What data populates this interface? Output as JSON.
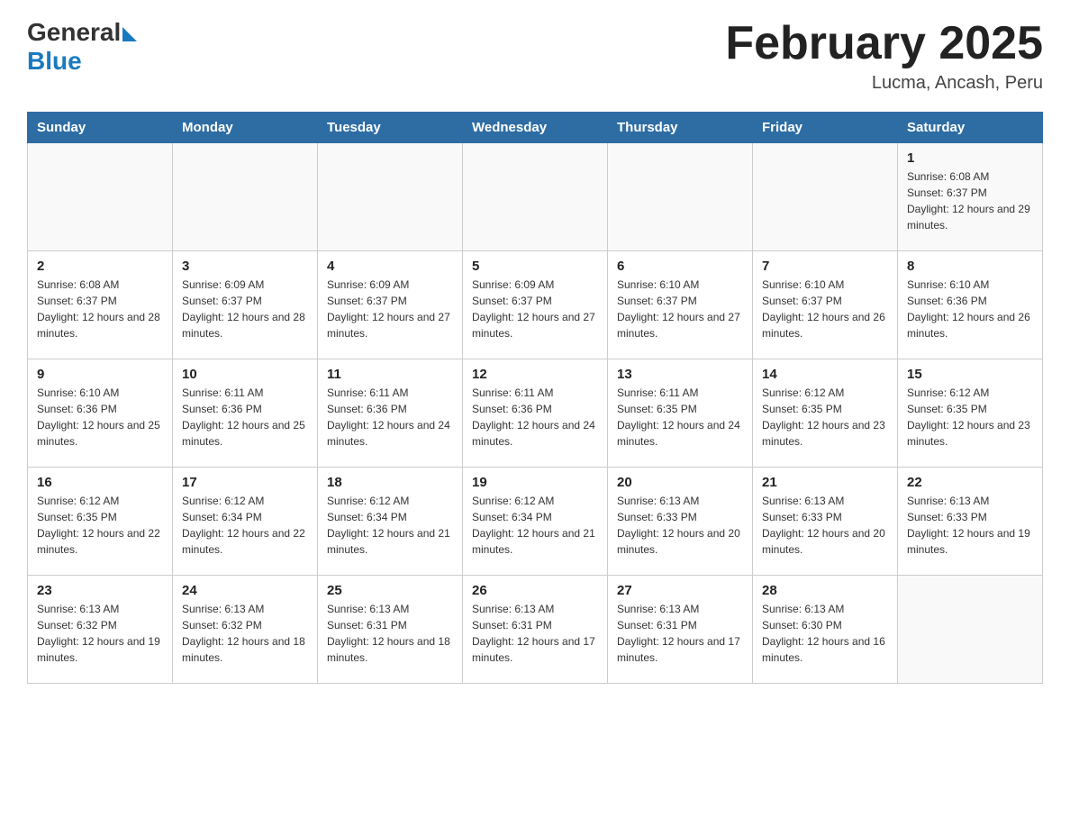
{
  "header": {
    "logo_general": "General",
    "logo_blue": "Blue",
    "month_title": "February 2025",
    "subtitle": "Lucma, Ancash, Peru"
  },
  "days_of_week": [
    "Sunday",
    "Monday",
    "Tuesday",
    "Wednesday",
    "Thursday",
    "Friday",
    "Saturday"
  ],
  "weeks": [
    [
      {
        "day": "",
        "sunrise": "",
        "sunset": "",
        "daylight": ""
      },
      {
        "day": "",
        "sunrise": "",
        "sunset": "",
        "daylight": ""
      },
      {
        "day": "",
        "sunrise": "",
        "sunset": "",
        "daylight": ""
      },
      {
        "day": "",
        "sunrise": "",
        "sunset": "",
        "daylight": ""
      },
      {
        "day": "",
        "sunrise": "",
        "sunset": "",
        "daylight": ""
      },
      {
        "day": "",
        "sunrise": "",
        "sunset": "",
        "daylight": ""
      },
      {
        "day": "1",
        "sunrise": "Sunrise: 6:08 AM",
        "sunset": "Sunset: 6:37 PM",
        "daylight": "Daylight: 12 hours and 29 minutes."
      }
    ],
    [
      {
        "day": "2",
        "sunrise": "Sunrise: 6:08 AM",
        "sunset": "Sunset: 6:37 PM",
        "daylight": "Daylight: 12 hours and 28 minutes."
      },
      {
        "day": "3",
        "sunrise": "Sunrise: 6:09 AM",
        "sunset": "Sunset: 6:37 PM",
        "daylight": "Daylight: 12 hours and 28 minutes."
      },
      {
        "day": "4",
        "sunrise": "Sunrise: 6:09 AM",
        "sunset": "Sunset: 6:37 PM",
        "daylight": "Daylight: 12 hours and 27 minutes."
      },
      {
        "day": "5",
        "sunrise": "Sunrise: 6:09 AM",
        "sunset": "Sunset: 6:37 PM",
        "daylight": "Daylight: 12 hours and 27 minutes."
      },
      {
        "day": "6",
        "sunrise": "Sunrise: 6:10 AM",
        "sunset": "Sunset: 6:37 PM",
        "daylight": "Daylight: 12 hours and 27 minutes."
      },
      {
        "day": "7",
        "sunrise": "Sunrise: 6:10 AM",
        "sunset": "Sunset: 6:37 PM",
        "daylight": "Daylight: 12 hours and 26 minutes."
      },
      {
        "day": "8",
        "sunrise": "Sunrise: 6:10 AM",
        "sunset": "Sunset: 6:36 PM",
        "daylight": "Daylight: 12 hours and 26 minutes."
      }
    ],
    [
      {
        "day": "9",
        "sunrise": "Sunrise: 6:10 AM",
        "sunset": "Sunset: 6:36 PM",
        "daylight": "Daylight: 12 hours and 25 minutes."
      },
      {
        "day": "10",
        "sunrise": "Sunrise: 6:11 AM",
        "sunset": "Sunset: 6:36 PM",
        "daylight": "Daylight: 12 hours and 25 minutes."
      },
      {
        "day": "11",
        "sunrise": "Sunrise: 6:11 AM",
        "sunset": "Sunset: 6:36 PM",
        "daylight": "Daylight: 12 hours and 24 minutes."
      },
      {
        "day": "12",
        "sunrise": "Sunrise: 6:11 AM",
        "sunset": "Sunset: 6:36 PM",
        "daylight": "Daylight: 12 hours and 24 minutes."
      },
      {
        "day": "13",
        "sunrise": "Sunrise: 6:11 AM",
        "sunset": "Sunset: 6:35 PM",
        "daylight": "Daylight: 12 hours and 24 minutes."
      },
      {
        "day": "14",
        "sunrise": "Sunrise: 6:12 AM",
        "sunset": "Sunset: 6:35 PM",
        "daylight": "Daylight: 12 hours and 23 minutes."
      },
      {
        "day": "15",
        "sunrise": "Sunrise: 6:12 AM",
        "sunset": "Sunset: 6:35 PM",
        "daylight": "Daylight: 12 hours and 23 minutes."
      }
    ],
    [
      {
        "day": "16",
        "sunrise": "Sunrise: 6:12 AM",
        "sunset": "Sunset: 6:35 PM",
        "daylight": "Daylight: 12 hours and 22 minutes."
      },
      {
        "day": "17",
        "sunrise": "Sunrise: 6:12 AM",
        "sunset": "Sunset: 6:34 PM",
        "daylight": "Daylight: 12 hours and 22 minutes."
      },
      {
        "day": "18",
        "sunrise": "Sunrise: 6:12 AM",
        "sunset": "Sunset: 6:34 PM",
        "daylight": "Daylight: 12 hours and 21 minutes."
      },
      {
        "day": "19",
        "sunrise": "Sunrise: 6:12 AM",
        "sunset": "Sunset: 6:34 PM",
        "daylight": "Daylight: 12 hours and 21 minutes."
      },
      {
        "day": "20",
        "sunrise": "Sunrise: 6:13 AM",
        "sunset": "Sunset: 6:33 PM",
        "daylight": "Daylight: 12 hours and 20 minutes."
      },
      {
        "day": "21",
        "sunrise": "Sunrise: 6:13 AM",
        "sunset": "Sunset: 6:33 PM",
        "daylight": "Daylight: 12 hours and 20 minutes."
      },
      {
        "day": "22",
        "sunrise": "Sunrise: 6:13 AM",
        "sunset": "Sunset: 6:33 PM",
        "daylight": "Daylight: 12 hours and 19 minutes."
      }
    ],
    [
      {
        "day": "23",
        "sunrise": "Sunrise: 6:13 AM",
        "sunset": "Sunset: 6:32 PM",
        "daylight": "Daylight: 12 hours and 19 minutes."
      },
      {
        "day": "24",
        "sunrise": "Sunrise: 6:13 AM",
        "sunset": "Sunset: 6:32 PM",
        "daylight": "Daylight: 12 hours and 18 minutes."
      },
      {
        "day": "25",
        "sunrise": "Sunrise: 6:13 AM",
        "sunset": "Sunset: 6:31 PM",
        "daylight": "Daylight: 12 hours and 18 minutes."
      },
      {
        "day": "26",
        "sunrise": "Sunrise: 6:13 AM",
        "sunset": "Sunset: 6:31 PM",
        "daylight": "Daylight: 12 hours and 17 minutes."
      },
      {
        "day": "27",
        "sunrise": "Sunrise: 6:13 AM",
        "sunset": "Sunset: 6:31 PM",
        "daylight": "Daylight: 12 hours and 17 minutes."
      },
      {
        "day": "28",
        "sunrise": "Sunrise: 6:13 AM",
        "sunset": "Sunset: 6:30 PM",
        "daylight": "Daylight: 12 hours and 16 minutes."
      },
      {
        "day": "",
        "sunrise": "",
        "sunset": "",
        "daylight": ""
      }
    ]
  ]
}
